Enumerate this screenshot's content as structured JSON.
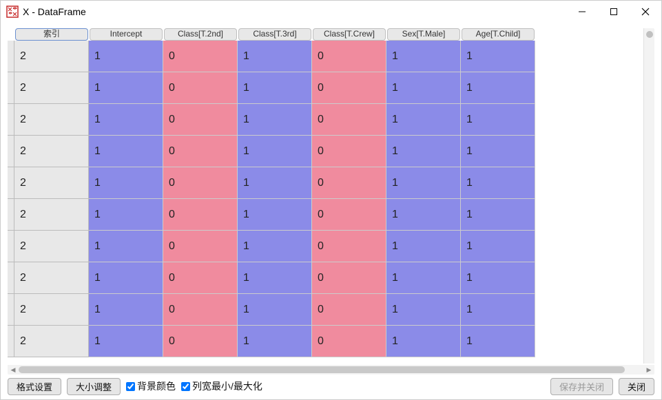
{
  "window": {
    "title": "X - DataFrame"
  },
  "table": {
    "index_header": "索引",
    "columns": [
      "Intercept",
      "Class[T.2nd]",
      "Class[T.3rd]",
      "Class[T.Crew]",
      "Sex[T.Male]",
      "Age[T.Child]"
    ],
    "index": [
      "2",
      "2",
      "2",
      "2",
      "2",
      "2",
      "2",
      "2",
      "2",
      "2"
    ],
    "rows": [
      [
        "1",
        "0",
        "1",
        "0",
        "1",
        "1"
      ],
      [
        "1",
        "0",
        "1",
        "0",
        "1",
        "1"
      ],
      [
        "1",
        "0",
        "1",
        "0",
        "1",
        "1"
      ],
      [
        "1",
        "0",
        "1",
        "0",
        "1",
        "1"
      ],
      [
        "1",
        "0",
        "1",
        "0",
        "1",
        "1"
      ],
      [
        "1",
        "0",
        "1",
        "0",
        "1",
        "1"
      ],
      [
        "1",
        "0",
        "1",
        "0",
        "1",
        "1"
      ],
      [
        "1",
        "0",
        "1",
        "0",
        "1",
        "1"
      ],
      [
        "1",
        "0",
        "1",
        "0",
        "1",
        "1"
      ],
      [
        "1",
        "0",
        "1",
        "0",
        "1",
        "1"
      ]
    ]
  },
  "footer": {
    "format_btn": "格式设置",
    "resize_btn": "大小调整",
    "bgcolor_chk": "背景颜色",
    "colwidth_chk": "列宽最小/最大化",
    "save_close_btn": "保存并关闭",
    "close_btn": "关闭"
  }
}
